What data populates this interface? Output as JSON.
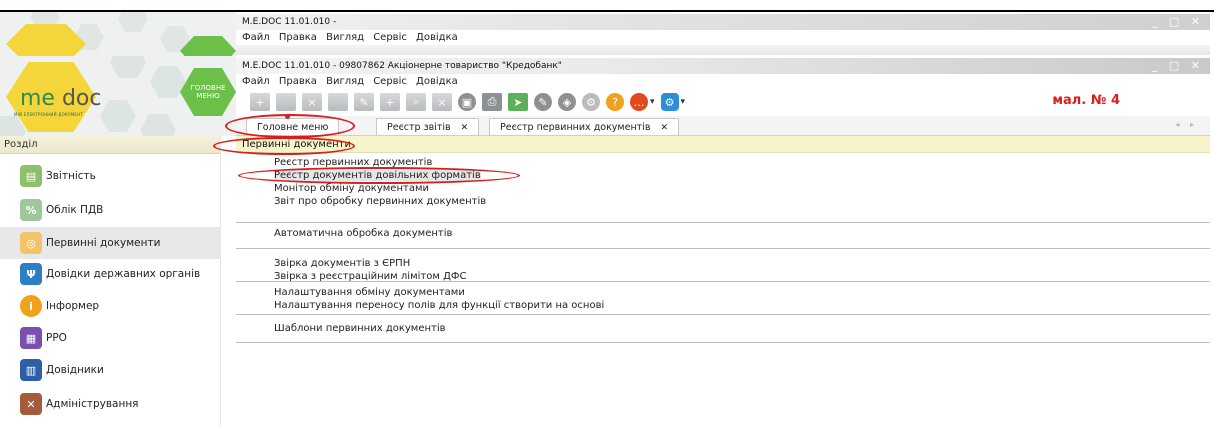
{
  "back_window": {
    "title": "M.E.DOC 11.01.010 -",
    "menu": [
      "Файл",
      "Правка",
      "Вигляд",
      "Сервіс",
      "Довідка"
    ]
  },
  "front_window": {
    "title": "M.E.DOC 11.01.010 - 09807862 Акціонерне товариство \"Кредобанк\"",
    "menu": [
      "Файл",
      "Правка",
      "Вигляд",
      "Сервіс",
      "Довідка"
    ],
    "window_buttons": "_ □ ✕"
  },
  "logo": {
    "me": "me",
    "doc": "doc",
    "subtitle": "МІЙ ЕЛЕКТРОННИЙ ДОКУМЕНТ",
    "main_menu_button": "ГОЛОВНЕ МЕНЮ"
  },
  "figure_label": "мал. № 4",
  "tabs": [
    {
      "label": "Головне меню"
    },
    {
      "label": "Реєстр звітів",
      "close": "✕"
    },
    {
      "label": "Реєстр первинних документів",
      "close": "✕"
    }
  ],
  "toolbar_icons": [
    "new-doc-icon",
    "open-folder-icon",
    "delete-doc-icon",
    "copy-icon",
    "edit-icon",
    "add-icon",
    "search-icon",
    "remove-icon",
    "archive-icon",
    "print-icon",
    "send-icon",
    "sign-icon",
    "shield-icon",
    "settings-icon",
    "help-icon",
    "chat-icon",
    "network-icon"
  ],
  "left_panel": {
    "header": "Розділ",
    "items": [
      {
        "label": "Звітність",
        "icon": "report-icon",
        "color": "#8fbf6a"
      },
      {
        "label": "Облік ПДВ",
        "icon": "vat-icon",
        "color": "#9fc89a"
      },
      {
        "label": "Первинні документи",
        "icon": "primary-docs-icon",
        "color": "#f2c36a"
      },
      {
        "label": "Довідки державних органів",
        "icon": "trident-icon",
        "color": "#2c7fc6"
      },
      {
        "label": "Інформер",
        "icon": "informer-icon",
        "color": "#f0a21c"
      },
      {
        "label": "РРО",
        "icon": "cash-register-icon",
        "color": "#7a4fb0"
      },
      {
        "label": "Довідники",
        "icon": "book-icon",
        "color": "#2c5fa8"
      },
      {
        "label": "Адміністрування",
        "icon": "tools-icon",
        "color": "#a55a3c"
      }
    ]
  },
  "content": {
    "header": "Первинні документи",
    "groups": [
      [
        "Реєстр первинних документів",
        "Реєстр документів довільних форматів",
        "Монітор обміну документами",
        "Звіт про обробку первинних документів"
      ],
      [
        "Автоматична обробка документів"
      ],
      [
        "Звірка документів з ЄРПН",
        "Звірка з реєстраційним лімітом ДФС"
      ],
      [
        "Налаштування обміну документами",
        "Налаштування переносу полів для функції створити на основі"
      ],
      [
        "Шаблони первинних документів"
      ]
    ]
  }
}
